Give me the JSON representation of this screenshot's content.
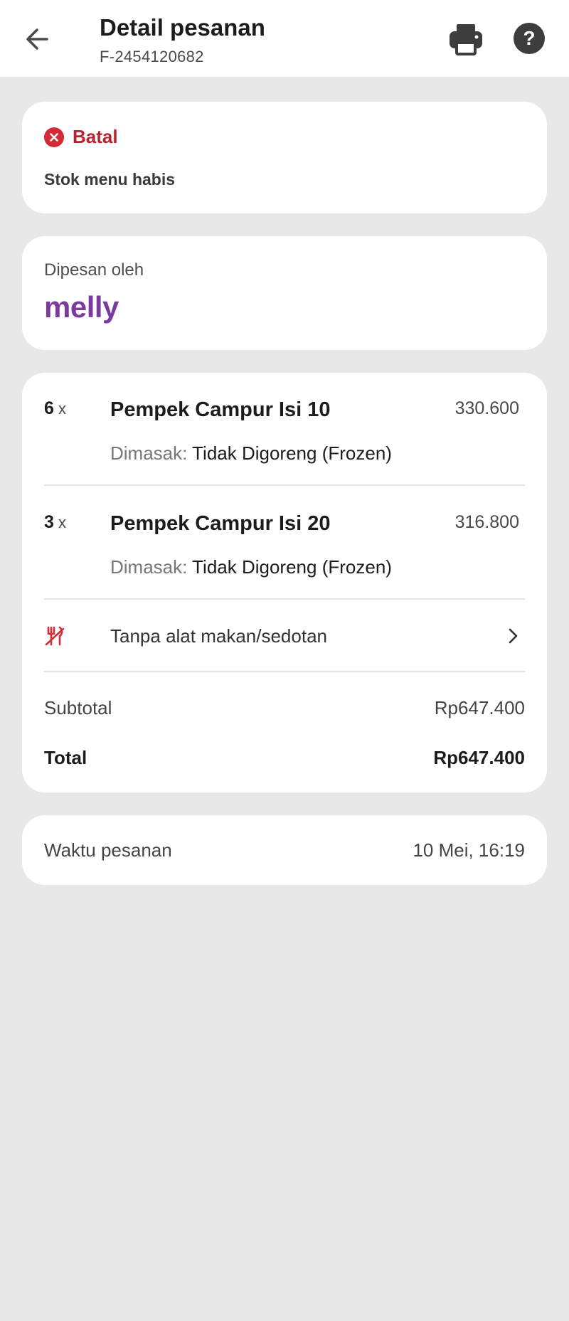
{
  "header": {
    "title": "Detail pesanan",
    "order_id": "F-2454120682"
  },
  "status": {
    "label": "Batal",
    "reason": "Stok menu habis",
    "color": "#b8232f"
  },
  "customer": {
    "label": "Dipesan oleh",
    "name": "melly",
    "name_color": "#7b3a9e"
  },
  "items": [
    {
      "qty": "6",
      "qty_suffix": "x",
      "name": "Pempek Campur Isi 10",
      "price": "330.600",
      "note_key": "Dimasak:",
      "note_value": "Tidak Digoreng (Frozen)"
    },
    {
      "qty": "3",
      "qty_suffix": "x",
      "name": "Pempek Campur Isi 20",
      "price": "316.800",
      "note_key": "Dimasak:",
      "note_value": "Tidak Digoreng (Frozen)"
    }
  ],
  "cutlery": {
    "label": "Tanpa alat makan/sedotan",
    "icon": "no-cutlery-icon"
  },
  "summary": {
    "subtotal_label": "Subtotal",
    "subtotal_value": "Rp647.400",
    "total_label": "Total",
    "total_value": "Rp647.400"
  },
  "order_time": {
    "label": "Waktu pesanan",
    "value": "10 Mei, 16:19"
  }
}
